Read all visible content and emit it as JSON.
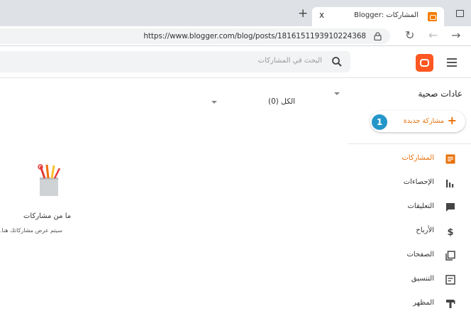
{
  "browser": {
    "tab_title": "المشاركات :Blogger",
    "tab_close": "x",
    "new_tab": "+",
    "url": "https://www.blogger.com/blog/posts/1816151193910224368",
    "nav_back": "←",
    "nav_forward": "→",
    "nav_reload": "↻"
  },
  "header": {
    "search_placeholder": "البحث في المشاركات"
  },
  "sidebar": {
    "blog_title": "عادات صحية",
    "new_post_label": "مشاركة جديدة",
    "step_badge": "1",
    "items": [
      {
        "label": "المشاركات",
        "icon": "posts-icon",
        "active": true
      },
      {
        "label": "الإحصاءات",
        "icon": "stats-icon",
        "active": false
      },
      {
        "label": "التعليقات",
        "icon": "comments-icon",
        "active": false
      },
      {
        "label": "الأرباح",
        "icon": "earnings-icon",
        "active": false
      },
      {
        "label": "الصفحات",
        "icon": "pages-icon",
        "active": false
      },
      {
        "label": "التنسيق",
        "icon": "layout-icon",
        "active": false
      },
      {
        "label": "المظهر",
        "icon": "theme-icon",
        "active": false
      }
    ]
  },
  "main": {
    "filter_label": "الكل (0)",
    "empty_title": "ما من مشاركات",
    "empty_subtitle": "سيتم عرض مشاركاتك هنا."
  },
  "colors": {
    "accent": "#e8710a",
    "logo": "#ff5722",
    "badge": "#2496c9"
  }
}
